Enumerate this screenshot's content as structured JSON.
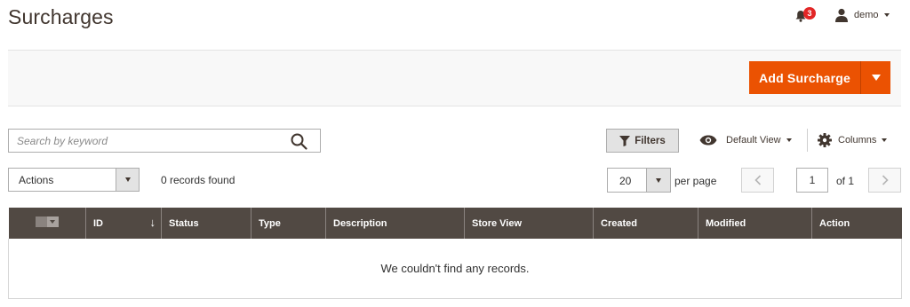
{
  "header": {
    "title": "Surcharges",
    "notifications_count": "3",
    "user_name": "demo"
  },
  "toolbar": {
    "add_label": "Add Surcharge"
  },
  "search": {
    "placeholder": "Search by keyword",
    "value": ""
  },
  "controls": {
    "filters_label": "Filters",
    "view_label": "Default View",
    "columns_label": "Columns"
  },
  "listing": {
    "actions_label": "Actions",
    "records_found": "0 records found",
    "per_page_value": "20",
    "per_page_label": "per page",
    "current_page": "1",
    "total_pages_label": "of 1"
  },
  "table": {
    "columns": [
      "ID",
      "Status",
      "Type",
      "Description",
      "Store View",
      "Created",
      "Modified",
      "Action"
    ],
    "sort_indicator": "↓",
    "empty_message": "We couldn't find any records."
  },
  "colors": {
    "accent": "#eb5202",
    "table_header": "#514943",
    "badge": "#e22626"
  }
}
